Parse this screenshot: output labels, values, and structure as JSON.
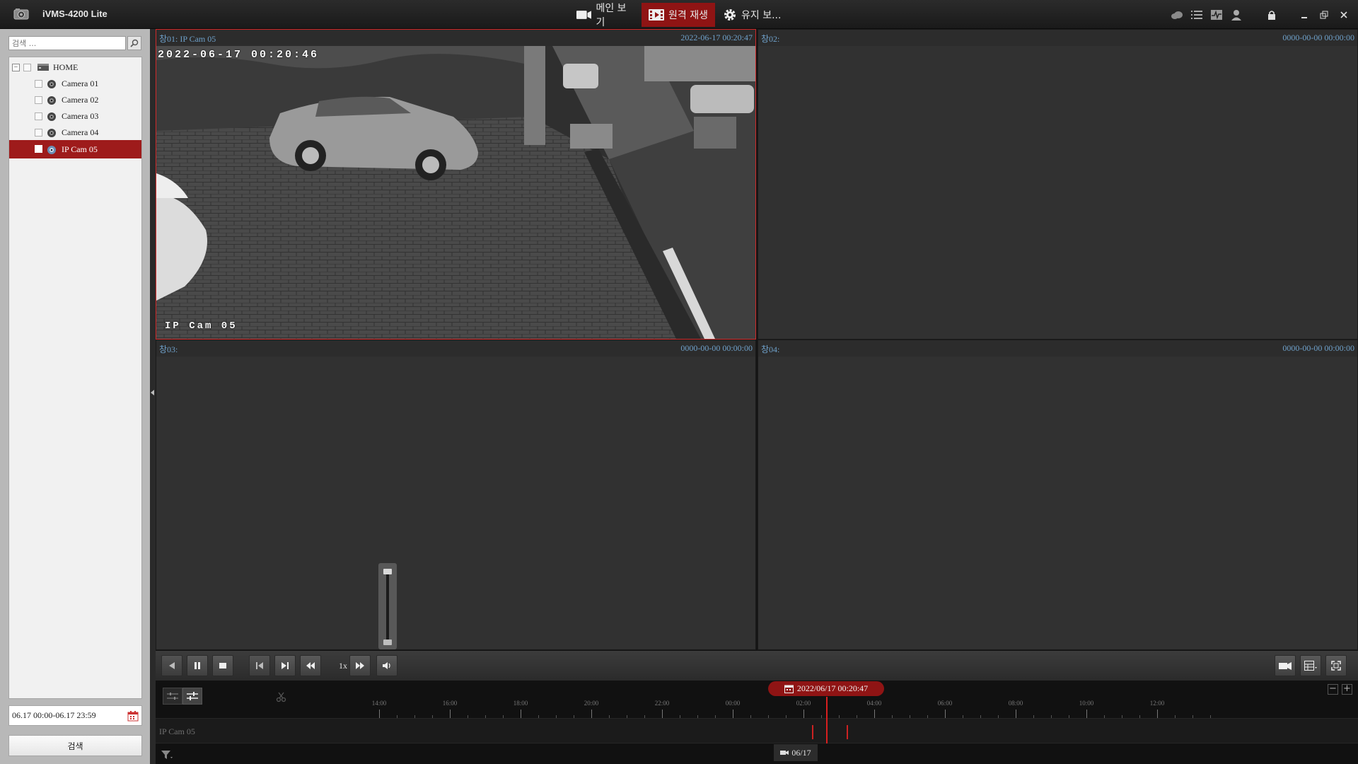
{
  "app": {
    "title": "iVMS-4200 Lite"
  },
  "main_tabs": [
    {
      "label": "메인 보기",
      "icon": "video-camera-icon",
      "active": false
    },
    {
      "label": "원격 재생",
      "icon": "film-playback-icon",
      "active": true
    },
    {
      "label": "유지 보...",
      "icon": "gear-icon",
      "active": false
    }
  ],
  "system_icons": [
    "cloud-icon",
    "list-icon",
    "activity-icon",
    "user-icon",
    "lock-icon",
    "minimize-icon",
    "restore-icon",
    "close-icon"
  ],
  "left_panel": {
    "search_placeholder": "검색 ...",
    "tree": [
      {
        "label": "HOME",
        "type": "group",
        "icon": "dvr-icon",
        "expanded": true,
        "selected": false
      },
      {
        "label": "Camera 01",
        "type": "camera",
        "icon": "dome-camera-icon",
        "selected": false
      },
      {
        "label": "Camera 02",
        "type": "camera",
        "icon": "dome-camera-icon",
        "selected": false
      },
      {
        "label": "Camera 03",
        "type": "camera",
        "icon": "dome-camera-icon",
        "selected": false
      },
      {
        "label": "Camera 04",
        "type": "camera",
        "icon": "dome-camera-icon",
        "selected": false
      },
      {
        "label": "IP Cam 05",
        "type": "camera",
        "icon": "dome-camera-icon",
        "selected": true
      }
    ],
    "date_range": "06.17 00:00-06.17 23:59",
    "search_button": "검색"
  },
  "panes": [
    {
      "name": "창01:  IP Cam 05",
      "time": "2022-06-17 00:20:47",
      "active": true,
      "osd_time": "2022-06-17 00:20:46",
      "osd_name": "IP Cam 05"
    },
    {
      "name": "창02:",
      "time": "0000-00-00 00:00:00",
      "active": false
    },
    {
      "name": "창03:",
      "time": "0000-00-00 00:00:00",
      "active": false
    },
    {
      "name": "창04:",
      "time": "0000-00-00 00:00:00",
      "active": false
    }
  ],
  "volume": {
    "level": 0.95
  },
  "toolbar": {
    "speed": "1x",
    "buttons": [
      "reverse-play-icon",
      "pause-icon",
      "stop-icon",
      "frame-back-icon",
      "frame-forward-icon",
      "slow-down-icon",
      "speed-up-icon",
      "volume-icon"
    ],
    "right_buttons": [
      "capture-icon",
      "layout-icon",
      "fullscreen-icon"
    ]
  },
  "timeline": {
    "current_time": "2022/06/17 00:20:47",
    "tick_labels": [
      "14:00",
      "16:00",
      "18:00",
      "20:00",
      "22:00",
      "00:00",
      "02:00",
      "04:00",
      "06:00",
      "08:00",
      "10:00",
      "12:00"
    ],
    "track_label": "IP Cam 05",
    "date_badge": "06/17"
  }
}
